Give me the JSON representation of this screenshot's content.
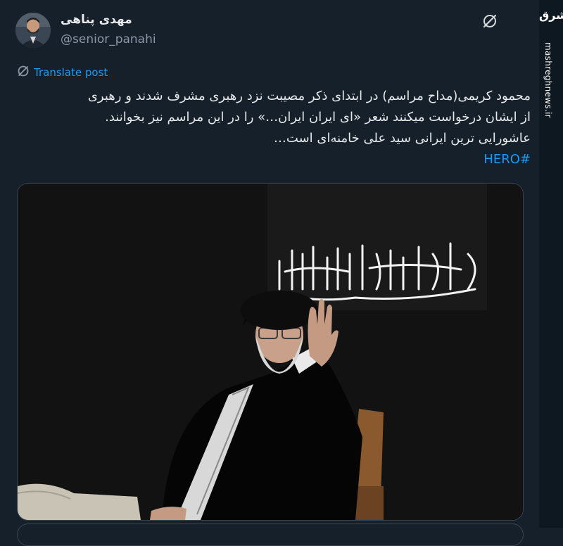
{
  "author": {
    "name": "مهدی پناهی",
    "handle": "@senior_panahi"
  },
  "icons": {
    "grok": "grok-icon",
    "translate": "translate-icon",
    "avatar": "avatar"
  },
  "translate_label": "Translate post",
  "post": {
    "lines": [
      "محمود کریمی(مداح مراسم) در ابتدای ذکر مصیبت نزد رهبری  مشرف شدند و رهبری",
      "از ایشان درخواست میکنند شعر «ای ایران ایران…» را در این مراسم نیز بخوانند.",
      "عاشورایی ترین ایرانی سید علی خامنه‌ای است…"
    ],
    "hashtag": "#HERO"
  },
  "watermark": {
    "logo": "مشرق",
    "url": "mashreghnews.ir"
  },
  "colors": {
    "background": "#15202b",
    "link": "#1d9bf0",
    "text": "#e7e9ea",
    "secondary": "#8b98a5"
  }
}
